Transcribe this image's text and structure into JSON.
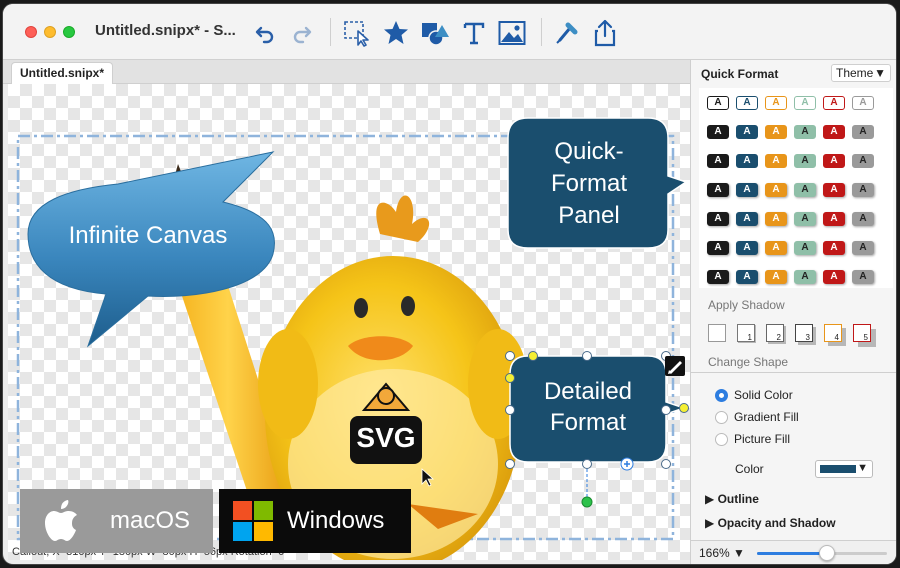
{
  "window": {
    "title": "Untitled.snipx* - S...",
    "tab_label": "Untitled.snipx*"
  },
  "toolbar": {
    "items": [
      "undo-icon",
      "redo-icon",
      "select-icon",
      "star-shape-icon",
      "shapes-icon",
      "text-tool-icon",
      "image-icon",
      "format-painter-icon",
      "share-icon"
    ]
  },
  "canvas": {
    "callout_infinite": "Infinite Canvas",
    "callout_quick_line1": "Quick-",
    "callout_quick_line2": "Format",
    "callout_quick_line3": "Panel",
    "callout_detailed_line1": "Detailed",
    "callout_detailed_line2": "Format",
    "svg_badge": "SVG",
    "status": "Callout, X=310px Y=180px W=80px H=56px Rotation=0"
  },
  "badges": {
    "mac": "macOS",
    "windows": "Windows"
  },
  "panel": {
    "title": "Quick Format",
    "theme_button": "Theme",
    "quick_format_letter": "A",
    "apply_shadow_label": "Apply Shadow",
    "shadow_boxes": [
      "",
      "1",
      "2",
      "3",
      "4",
      "5"
    ],
    "change_shape_label": "Change Shape",
    "fill_options": [
      {
        "label": "Solid Color",
        "selected": true
      },
      {
        "label": "Gradient Fill",
        "selected": false
      },
      {
        "label": "Picture Fill",
        "selected": false
      }
    ],
    "color_label": "Color",
    "color_value": "#1a4e6e",
    "outline_label": "Outline",
    "opacity_label": "Opacity and Shadow",
    "zoom_label": "166%",
    "zoom_fraction": 0.54
  },
  "colors": {
    "callout_dark": "#1a4e6e",
    "callout_light": "#3d8ec4",
    "accent_blue": "#2d7de0",
    "chick_yellow": "#f7c51e"
  }
}
